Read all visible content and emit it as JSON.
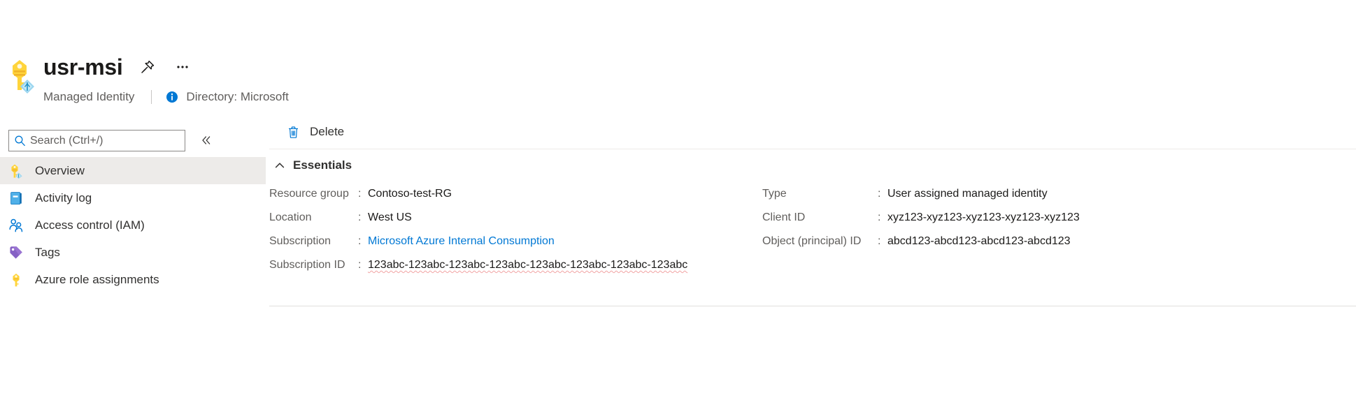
{
  "header": {
    "resource_icon": "managed-identity-key-icon",
    "title": "usr-msi",
    "pin_icon": "pin-icon",
    "more_icon": "ellipsis-icon",
    "subtitle": "Managed Identity",
    "info_icon": "info-icon",
    "directory": "Directory: Microsoft"
  },
  "sidebar": {
    "search": {
      "icon": "search-icon",
      "placeholder": "Search (Ctrl+/)",
      "value": ""
    },
    "collapse_icon": "double-chevron-left-icon",
    "items": [
      {
        "label": "Overview",
        "icon": "managed-identity-key-icon",
        "selected": true
      },
      {
        "label": "Activity log",
        "icon": "activity-log-book-icon",
        "selected": false
      },
      {
        "label": "Access control (IAM)",
        "icon": "access-control-people-icon",
        "selected": false
      },
      {
        "label": "Tags",
        "icon": "tag-icon",
        "selected": false
      },
      {
        "label": "Azure role assignments",
        "icon": "key-icon",
        "selected": false
      }
    ]
  },
  "content": {
    "commands": [
      {
        "label": "Delete",
        "icon": "trash-icon"
      }
    ],
    "essentials": {
      "chevron_icon": "chevron-up-icon",
      "title": "Essentials",
      "left_column": [
        {
          "label": "Resource group",
          "colon": ":",
          "value": "Contoso-test-RG",
          "link": false,
          "spell": false
        },
        {
          "label": "Location",
          "colon": ":",
          "value": "West US",
          "link": false,
          "spell": false
        },
        {
          "label": "Subscription",
          "colon": ":",
          "value": "Microsoft Azure Internal Consumption",
          "link": true,
          "spell": false
        },
        {
          "label": "Subscription ID",
          "colon": ":",
          "value": "123abc-123abc-123abc-123abc-123abc-123abc-123abc-123abc",
          "link": false,
          "spell": true
        }
      ],
      "right_column": [
        {
          "label": "Type",
          "colon": ":",
          "value": "User assigned managed identity",
          "link": false,
          "spell": false
        },
        {
          "label": "Client ID",
          "colon": ":",
          "value": "xyz123-xyz123-xyz123-xyz123-xyz123",
          "link": false,
          "spell": false
        },
        {
          "label": "Object (principal) ID",
          "colon": ":",
          "value": "abcd123-abcd123-abcd123-abcd123",
          "link": false,
          "spell": false
        }
      ]
    }
  },
  "colors": {
    "accent_blue": "#0078d4",
    "key_yellow": "#ffd24d",
    "tag_purple": "#8661c5",
    "selected_row": "#edebe9",
    "text_primary": "#1b1a19",
    "text_secondary": "#605e5c"
  }
}
